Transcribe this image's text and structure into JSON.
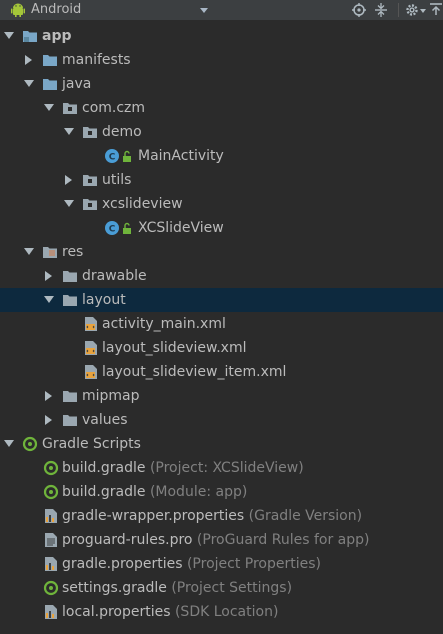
{
  "toolbar": {
    "view_label": "Android",
    "icons": [
      "android-icon",
      "crosshair-icon",
      "collapse-icon",
      "gear-icon",
      "hide-icon"
    ]
  },
  "colors": {
    "background": "#2b2b2b",
    "selection": "#0d293e",
    "folder": "#7aa7c7",
    "class_circle": "#4a9dd6",
    "gradle_green": "#6fb43b",
    "hint_text": "#808080"
  },
  "tree": {
    "app": "app",
    "manifests": "manifests",
    "java": "java",
    "com_czm": "com.czm",
    "demo": "demo",
    "main_activity": "MainActivity",
    "utils": "utils",
    "xcslideview": "xcslideview",
    "xcslideview_class": "XCSlideView",
    "res": "res",
    "drawable": "drawable",
    "layout": "layout",
    "activity_main": "activity_main.xml",
    "layout_slideview": "layout_slideview.xml",
    "layout_slideview_item": "layout_slideview_item.xml",
    "mipmap": "mipmap",
    "values": "values",
    "gradle_scripts": "Gradle Scripts",
    "build_gradle_project": "build.gradle",
    "build_gradle_project_hint": "(Project: XCSlideView)",
    "build_gradle_module": "build.gradle",
    "build_gradle_module_hint": "(Module: app)",
    "gradle_wrapper": "gradle-wrapper.properties",
    "gradle_wrapper_hint": "(Gradle Version)",
    "proguard": "proguard-rules.pro",
    "proguard_hint": "(ProGuard Rules for app)",
    "gradle_properties": "gradle.properties",
    "gradle_properties_hint": "(Project Properties)",
    "settings_gradle": "settings.gradle",
    "settings_gradle_hint": "(Project Settings)",
    "local_properties": "local.properties",
    "local_properties_hint": "(SDK Location)"
  }
}
